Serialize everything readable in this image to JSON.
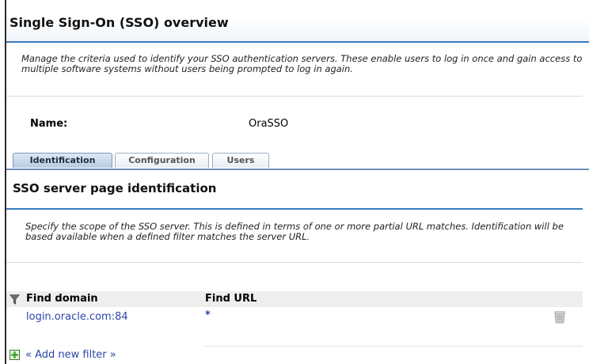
{
  "header": {
    "title": "Single Sign-On (SSO) overview"
  },
  "overview": {
    "description": "Manage the criteria used to identify your SSO authentication servers. These enable users to log in once and gain access to multiple software systems without users being prompted to log in again."
  },
  "record": {
    "name_label": "Name:",
    "name_value": "OraSSO"
  },
  "tabs": [
    {
      "label": "Identification",
      "active": true
    },
    {
      "label": "Configuration",
      "active": false
    },
    {
      "label": "Users",
      "active": false
    }
  ],
  "section": {
    "title": "SSO server page identification",
    "description": "Specify the scope of the SSO server. This is defined in terms of one or more partial URL matches. Identification will be based available when a defined filter matches the server URL."
  },
  "table": {
    "columns": [
      "Find domain",
      "Find URL"
    ],
    "rows": [
      {
        "domain": "login.oracle.com:84",
        "url": "*"
      }
    ]
  },
  "actions": {
    "add_filter": "« Add new filter »"
  },
  "icons": {
    "filter": "filter-funnel-icon",
    "delete": "trash-icon",
    "add": "plus-icon"
  },
  "colors": {
    "accent_line": "#3d7ac0",
    "link": "#2a46a8",
    "tab_active": "#b7cbe3"
  }
}
